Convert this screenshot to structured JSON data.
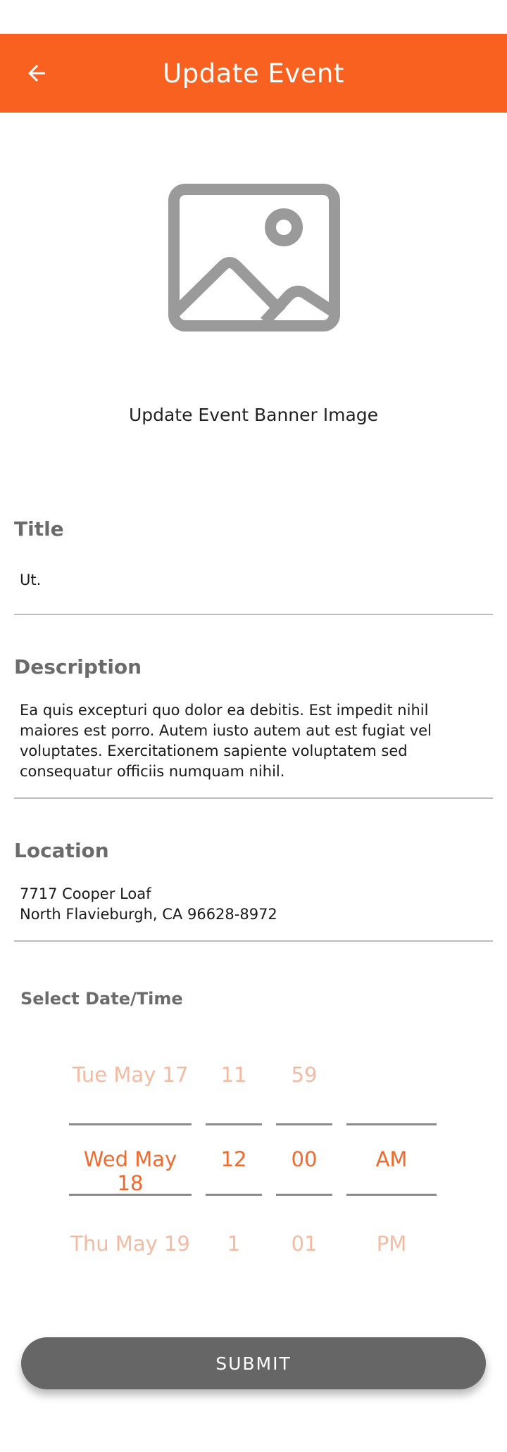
{
  "app_bar": {
    "title": "Update Event",
    "back_icon": "arrow-left-icon",
    "color": "#f86120"
  },
  "banner": {
    "icon": "image-placeholder-icon",
    "label": "Update Event Banner Image"
  },
  "title_field": {
    "label": "Title",
    "value": "Ut."
  },
  "description_field": {
    "label": "Description",
    "value": "Ea quis excepturi quo dolor ea debitis. Est impedit nihil maiores est porro. Autem iusto autem aut est fugiat vel voluptates. Exercitationem sapiente voluptatem sed consequatur officiis numquam nihil."
  },
  "location_field": {
    "label": "Location",
    "value": "7717 Cooper Loaf\nNorth Flavieburgh, CA 96628-8972"
  },
  "date_time": {
    "label": "Select Date/Time",
    "date": {
      "prev": "Tue May 17",
      "selected": "Wed May 18",
      "next": "Thu May 19"
    },
    "hour": {
      "prev": "11",
      "selected": "12",
      "next": "1"
    },
    "minute": {
      "prev": "59",
      "selected": "00",
      "next": "01"
    },
    "ampm": {
      "prev": "",
      "selected": "AM",
      "next": "PM"
    }
  },
  "submit": {
    "label": "SUBMIT",
    "color": "#666666"
  }
}
